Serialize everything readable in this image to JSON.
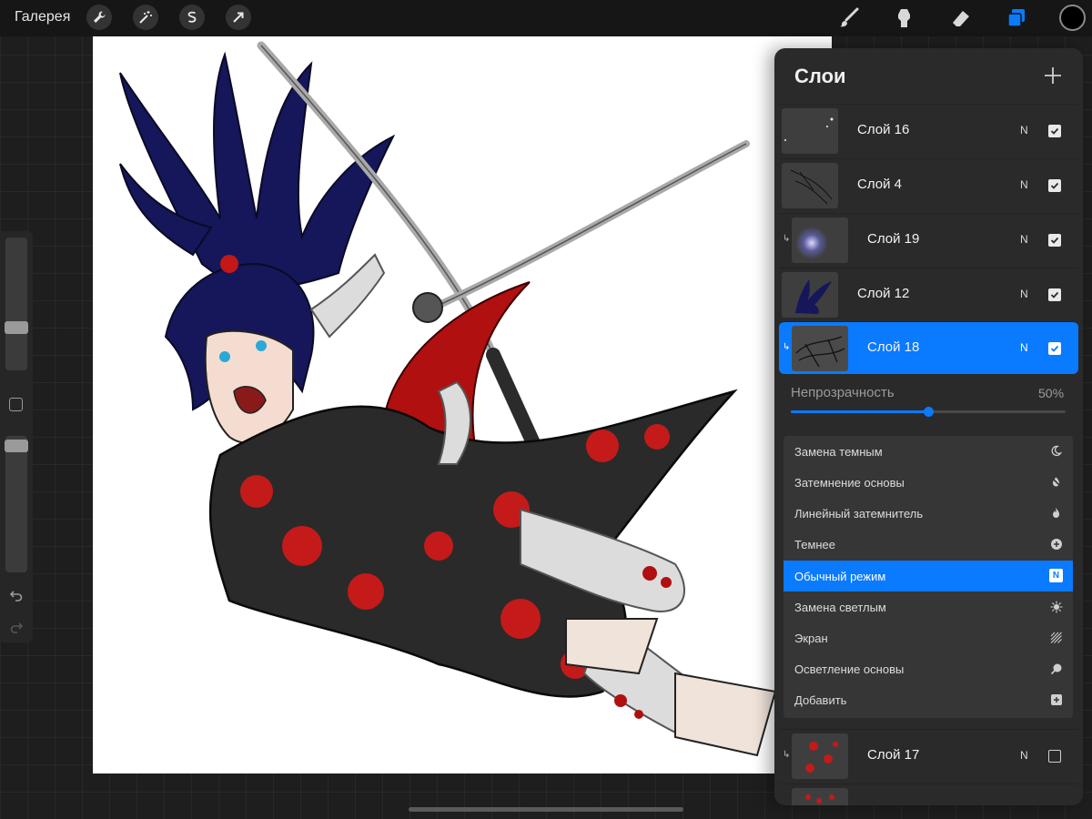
{
  "topbar": {
    "gallery_label": "Галерея",
    "left_tools": [
      "wrench-icon",
      "magic-wand-icon",
      "selection-icon",
      "transform-arrow-icon"
    ],
    "right_tools": [
      "brush-icon",
      "smudge-icon",
      "eraser-icon",
      "layers-icon"
    ],
    "accent_color": "#0a7aff",
    "current_color": "#000000"
  },
  "sidebar": {
    "brush_size_level": 0.3,
    "brush_opacity_level": 0.1,
    "icons": [
      "modify-square-icon",
      "undo-icon",
      "redo-icon"
    ]
  },
  "layers_panel": {
    "title": "Слои",
    "layers": [
      {
        "name": "Слой 16",
        "blend": "N",
        "visible": true,
        "selected": false,
        "clipped": false
      },
      {
        "name": "Слой 4",
        "blend": "N",
        "visible": true,
        "selected": false,
        "clipped": false
      },
      {
        "name": "Слой 19",
        "blend": "N",
        "visible": true,
        "selected": false,
        "clipped": true
      },
      {
        "name": "Слой 12",
        "blend": "N",
        "visible": true,
        "selected": false,
        "clipped": false
      },
      {
        "name": "Слой 18",
        "blend": "N",
        "visible": true,
        "selected": true,
        "clipped": true
      }
    ],
    "opacity": {
      "label": "Непрозрачность",
      "value_text": "50%",
      "value": 0.5
    },
    "blend_modes": [
      {
        "label": "Замена темным",
        "icon": "moon-icon",
        "active": false
      },
      {
        "label": "Затемнение основы",
        "icon": "burn-icon",
        "active": false
      },
      {
        "label": "Линейный затемнитель",
        "icon": "flame-icon",
        "active": false
      },
      {
        "label": "Темнее",
        "icon": "plus-circle-icon",
        "active": false
      },
      {
        "label": "Обычный режим",
        "icon": "n-badge-icon",
        "icon_text": "N",
        "active": true
      },
      {
        "label": "Замена светлым",
        "icon": "sun-icon",
        "active": false
      },
      {
        "label": "Экран",
        "icon": "hatch-icon",
        "active": false
      },
      {
        "label": "Осветление основы",
        "icon": "dodge-icon",
        "active": false
      },
      {
        "label": "Добавить",
        "icon": "plus-square-icon",
        "active": false
      }
    ],
    "bottom_layers": [
      {
        "name": "Слой 17",
        "blend": "N",
        "visible": false,
        "selected": false,
        "clipped": true
      }
    ]
  },
  "canvas": {
    "artwork": "anime-samurai-illustration",
    "background": "#ffffff"
  }
}
